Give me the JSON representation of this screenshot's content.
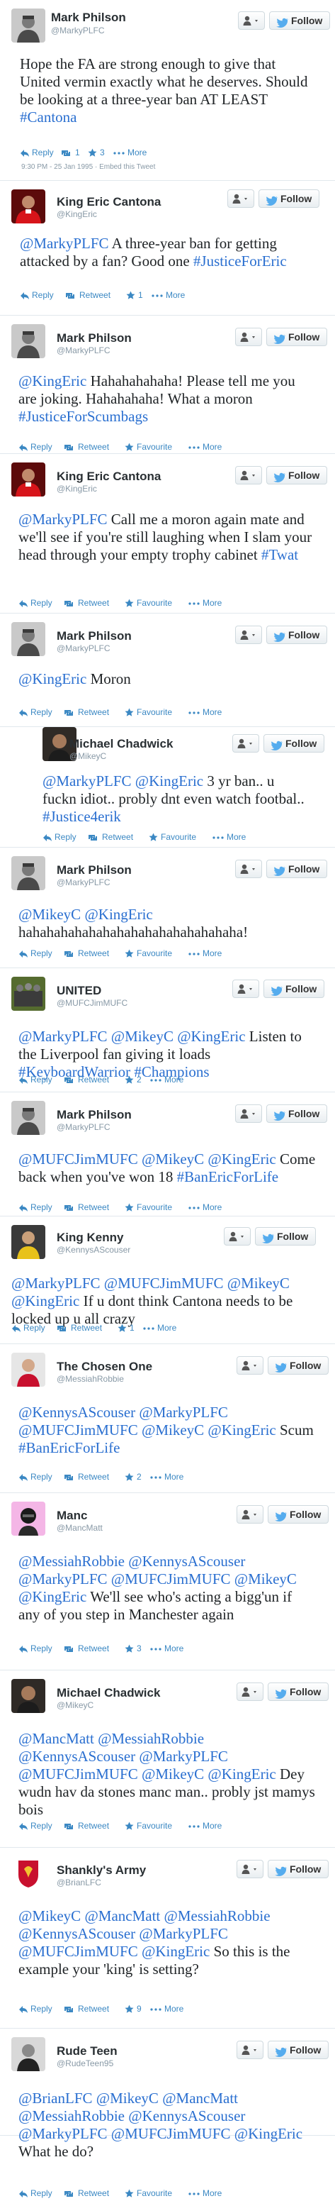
{
  "buttons": {
    "follow_label": "Follow"
  },
  "actions": {
    "reply": "Reply",
    "retweet": "Retweet",
    "favourite": "Favourite",
    "more": "More"
  },
  "colors": {
    "link": "#3b88c3",
    "mention": "#2a6fd0",
    "text": "#1f2326",
    "muted": "#8899a6",
    "border": "#e1e8ed"
  },
  "icons": {
    "reply": "reply-arrow-icon",
    "retweet": "retweet-icon",
    "favourite": "star-icon",
    "more": "more-dots-icon",
    "user_menu": "user-silhouette-icon",
    "follow": "follow-bird-icon"
  },
  "tweets": [
    {
      "name": "Mark Philson",
      "handle": "@MarkyPLFC",
      "text": "Hope the FA are strong enough to give that United vermin exactly what he deserves. Should be looking at a three-year ban AT LEAST #Cantona",
      "retweets": "1",
      "favourites": "3",
      "timestamp": "9:30 PM - 25 Jan 1995 · Embed this Tweet"
    },
    {
      "name": "King Eric Cantona",
      "handle": "@KingEric",
      "text": "@MarkyPLFC A three-year ban for getting attacked by a fan? Good one #JusticeForEric",
      "favourites": "1"
    },
    {
      "name": "Mark Philson",
      "handle": "@MarkyPLFC",
      "text": "@KingEric Hahahahahaha! Please tell me you are joking. Hahahahaha! What a moron #JusticeForScumbags"
    },
    {
      "name": "King Eric Cantona",
      "handle": "@KingEric",
      "text": "@MarkyPLFC Call me a moron again mate and we'll see if you're still laughing when I slam your head through your empty trophy cabinet #Twat"
    },
    {
      "name": "Mark Philson",
      "handle": "@MarkyPLFC",
      "text": "@KingEric Moron"
    },
    {
      "name": "Michael Chadwick",
      "handle": "@MikeyC",
      "text": "@MarkyPLFC @KingEric 3 yr ban.. u fuckn idiot.. probly dnt even watch footbal.. #Justice4erik"
    },
    {
      "name": "Mark Philson",
      "handle": "@MarkyPLFC",
      "text": "@MikeyC @KingEric hahahahahahahahahahahahahahahaha!"
    },
    {
      "name": "UNITED",
      "handle": "@MUFCJimMUFC",
      "text": "@MarkyPLFC @MikeyC @KingEric Listen to the Liverpool fan giving it loads #KeyboardWarrior #Champions",
      "favourites": "2"
    },
    {
      "name": "Mark Philson",
      "handle": "@MarkyPLFC",
      "text": "@MUFCJimMUFC @MikeyC @KingEric Come back when you've won 18 #BanEricForLife"
    },
    {
      "name": "King Kenny",
      "handle": "@KennysAScouser",
      "text": "@MarkyPLFC @MUFCJimMUFC @MikeyC @KingEric If u dont think Cantona needs to be locked up u all crazy",
      "favourites": "1"
    },
    {
      "name": "The Chosen One",
      "handle": "@MessiahRobbie",
      "text": "@KennysAScouser @MarkyPLFC @MUFCJimMUFC @MikeyC @KingEric Scum #BanEricForLife",
      "favourites": "2"
    },
    {
      "name": "Manc",
      "handle": "@MancMatt",
      "text": "@MessiahRobbie @KennysAScouser @MarkyPLFC @MUFCJimMUFC @MikeyC @KingEric We'll see who's acting a bigg'un if any of you step in Manchester again",
      "favourites": "3"
    },
    {
      "name": "Michael Chadwick",
      "handle": "@MikeyC",
      "text": "@MancMatt @MessiahRobbie @KennysAScouser @MarkyPLFC @MUFCJimMUFC @MikeyC @KingEric Dey wudn hav da stones manc man.. probly jst mamys bois"
    },
    {
      "name": "Shankly's Army",
      "handle": "@BrianLFC",
      "text": "@MikeyC @MancMatt @MessiahRobbie @KennysAScouser @MarkyPLFC @MUFCJimMUFC @KingEric So this is the example your 'king' is setting?",
      "favourites": "9"
    },
    {
      "name": "Rude Teen",
      "handle": "@RudeTeen95",
      "text": "@BrianLFC @MikeyC @MancMatt @MessiahRobbie @KennysAScouser @MarkyPLFC @MUFCJimMUFC @KingEric What he do?"
    }
  ]
}
